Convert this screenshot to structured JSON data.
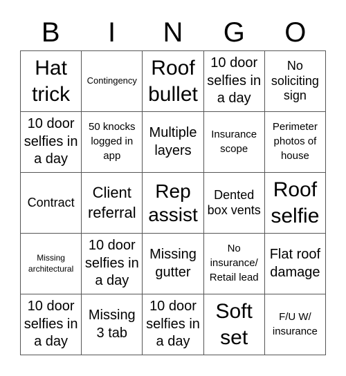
{
  "header": {
    "letters": [
      "B",
      "I",
      "N",
      "G",
      "O"
    ]
  },
  "cells": [
    [
      "Hat trick",
      "Contingency",
      "Roof bullet",
      "10 door selfies in a day",
      "No soliciting sign"
    ],
    [
      "10 door selfies in a day",
      "50 knocks logged in app",
      "Multiple layers",
      "Insurance scope",
      "Perimeter photos of house"
    ],
    [
      "Contract",
      "Client referral",
      "Rep assist",
      "Dented box vents",
      "Roof selfie"
    ],
    [
      "Missing architectural",
      "10 door selfies in a day",
      "Missing gutter",
      "No insurance/ Retail lead",
      "Flat roof damage"
    ],
    [
      "10 door selfies in a day",
      "Missing 3 tab",
      "10 door selfies in a day",
      "Soft set",
      "F/U W/ insurance"
    ]
  ]
}
